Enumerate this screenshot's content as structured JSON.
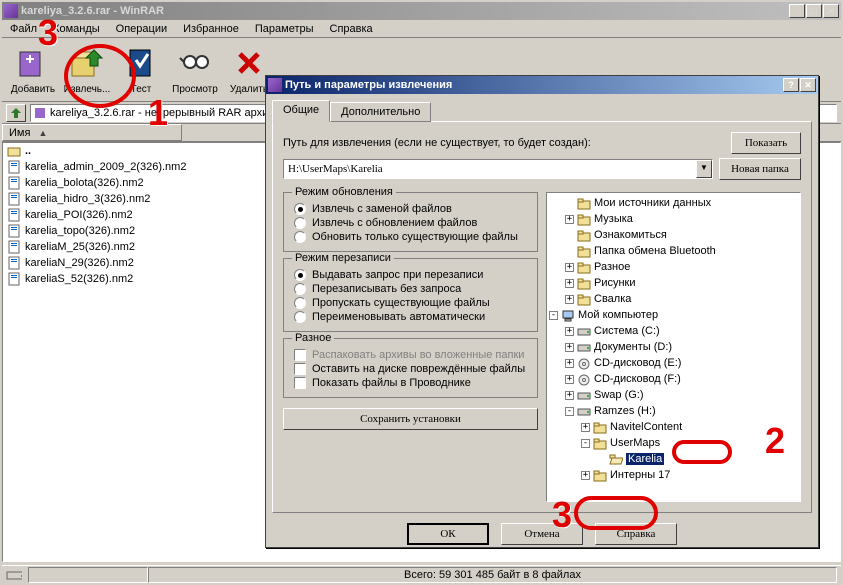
{
  "window": {
    "title": "kareliya_3.2.6.rar - WinRAR"
  },
  "menu": [
    "Файл",
    "Команды",
    "Операции",
    "Избранное",
    "Параметры",
    "Справка"
  ],
  "toolbar": {
    "add": "Добавить",
    "extract": "Извлечь...",
    "test": "Тест",
    "view": "Просмотр",
    "delete": "Удалить"
  },
  "address": "kareliya_3.2.6.rar - непрерывный RAR архив",
  "list_header": "Имя",
  "files": [
    "..",
    "karelia_admin_2009_2(326).nm2",
    "karelia_bolota(326).nm2",
    "karelia_hidro_3(326).nm2",
    "karelia_POI(326).nm2",
    "karelia_topo(326).nm2",
    "kareliaM_25(326).nm2",
    "kareliaN_29(326).nm2",
    "kareliaS_52(326).nm2"
  ],
  "status": "Всего: 59 301 485 байт в 8 файлах",
  "dialog": {
    "title": "Путь и параметры извлечения",
    "tab_general": "Общие",
    "tab_advanced": "Дополнительно",
    "path_label": "Путь для извлечения (если не существует, то будет создан):",
    "path_value": "H:\\UserMaps\\Karelia",
    "show_btn": "Показать",
    "new_folder_btn": "Новая папка",
    "update_mode": {
      "title": "Режим обновления",
      "r1": "Извлечь с заменой файлов",
      "r2": "Извлечь с обновлением файлов",
      "r3": "Обновить только существующие файлы"
    },
    "overwrite_mode": {
      "title": "Режим перезаписи",
      "r1": "Выдавать запрос при перезаписи",
      "r2": "Перезаписывать без запроса",
      "r3": "Пропускать существующие файлы",
      "r4": "Переименовывать автоматически"
    },
    "misc": {
      "title": "Разное",
      "c1": "Распаковать архивы во вложенные папки",
      "c2": "Оставить на диске повреждённые файлы",
      "c3": "Показать файлы в Проводнике"
    },
    "save_btn": "Сохранить установки",
    "ok_btn": "ОК",
    "cancel_btn": "Отмена",
    "help_btn": "Справка"
  },
  "tree": [
    {
      "indent": 0,
      "toggle": "",
      "icon": "folder",
      "label": "Мои источники данных"
    },
    {
      "indent": 0,
      "toggle": "+",
      "icon": "folder",
      "label": "Музыка"
    },
    {
      "indent": 0,
      "toggle": "",
      "icon": "folder",
      "label": "Ознакомиться"
    },
    {
      "indent": 0,
      "toggle": "",
      "icon": "folder",
      "label": "Папка обмена Bluetooth"
    },
    {
      "indent": 0,
      "toggle": "+",
      "icon": "folder",
      "label": "Разное"
    },
    {
      "indent": 0,
      "toggle": "+",
      "icon": "folder",
      "label": "Рисунки"
    },
    {
      "indent": 0,
      "toggle": "+",
      "icon": "folder",
      "label": "Свалка"
    },
    {
      "indent": -1,
      "toggle": "-",
      "icon": "computer",
      "label": "Мой компьютер"
    },
    {
      "indent": 0,
      "toggle": "+",
      "icon": "drive",
      "label": "Система (C:)"
    },
    {
      "indent": 0,
      "toggle": "+",
      "icon": "drive",
      "label": "Документы (D:)"
    },
    {
      "indent": 0,
      "toggle": "+",
      "icon": "cd",
      "label": "CD-дисковод (E:)"
    },
    {
      "indent": 0,
      "toggle": "+",
      "icon": "cd",
      "label": "CD-дисковод (F:)"
    },
    {
      "indent": 0,
      "toggle": "+",
      "icon": "drive",
      "label": "Swap (G:)"
    },
    {
      "indent": 0,
      "toggle": "-",
      "icon": "drive",
      "label": "Ramzes (H:)"
    },
    {
      "indent": 1,
      "toggle": "+",
      "icon": "folder",
      "label": "NavitelContent"
    },
    {
      "indent": 1,
      "toggle": "-",
      "icon": "folder",
      "label": "UserMaps"
    },
    {
      "indent": 2,
      "toggle": "",
      "icon": "folder-open",
      "label": "Karelia",
      "selected": true
    },
    {
      "indent": 1,
      "toggle": "+",
      "icon": "folder",
      "label": "Интерны 17"
    }
  ],
  "annotations": {
    "n1": "1",
    "n2": "2",
    "n3": "3"
  }
}
